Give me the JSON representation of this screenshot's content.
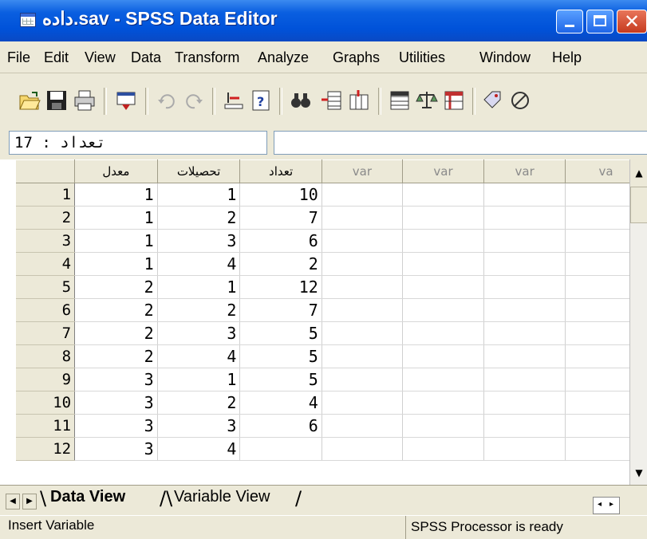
{
  "window": {
    "title": "داده.sav - SPSS Data Editor"
  },
  "menu": [
    "File",
    "Edit",
    "View",
    "Data",
    "Transform",
    "Analyze",
    "Graphs",
    "Utilities",
    "Window",
    "Help"
  ],
  "toolbar_icons": [
    "open-icon",
    "save-icon",
    "print-icon",
    "dialog-recall-icon",
    "undo-icon",
    "redo-icon",
    "goto-case-icon",
    "variables-icon",
    "find-icon",
    "insert-cases-icon",
    "insert-variable-icon",
    "split-file-icon",
    "weight-cases-icon",
    "select-cases-icon",
    "value-labels-icon",
    "use-sets-icon"
  ],
  "cell_editor": {
    "reference": "17 : تعداد",
    "value": ""
  },
  "grid": {
    "columns": [
      "معدل",
      "تحصیلات",
      "تعداد",
      "var",
      "var",
      "var",
      "va"
    ],
    "rows": [
      {
        "num": "1",
        "c": [
          "1",
          "1",
          "10"
        ]
      },
      {
        "num": "2",
        "c": [
          "1",
          "2",
          "7"
        ]
      },
      {
        "num": "3",
        "c": [
          "1",
          "3",
          "6"
        ]
      },
      {
        "num": "4",
        "c": [
          "1",
          "4",
          "2"
        ]
      },
      {
        "num": "5",
        "c": [
          "2",
          "1",
          "12"
        ]
      },
      {
        "num": "6",
        "c": [
          "2",
          "2",
          "7"
        ]
      },
      {
        "num": "7",
        "c": [
          "2",
          "3",
          "5"
        ]
      },
      {
        "num": "8",
        "c": [
          "2",
          "4",
          "5"
        ]
      },
      {
        "num": "9",
        "c": [
          "3",
          "1",
          "5"
        ]
      },
      {
        "num": "10",
        "c": [
          "3",
          "2",
          "4"
        ]
      },
      {
        "num": "11",
        "c": [
          "3",
          "3",
          "6"
        ]
      },
      {
        "num": "12",
        "c": [
          "3",
          "4",
          "",
          "",
          "",
          "",
          ""
        ]
      }
    ]
  },
  "tabs": {
    "data_view": "Data View",
    "variable_view": "Variable View"
  },
  "status": {
    "left": "Insert Variable",
    "right": "SPSS Processor  is ready"
  }
}
